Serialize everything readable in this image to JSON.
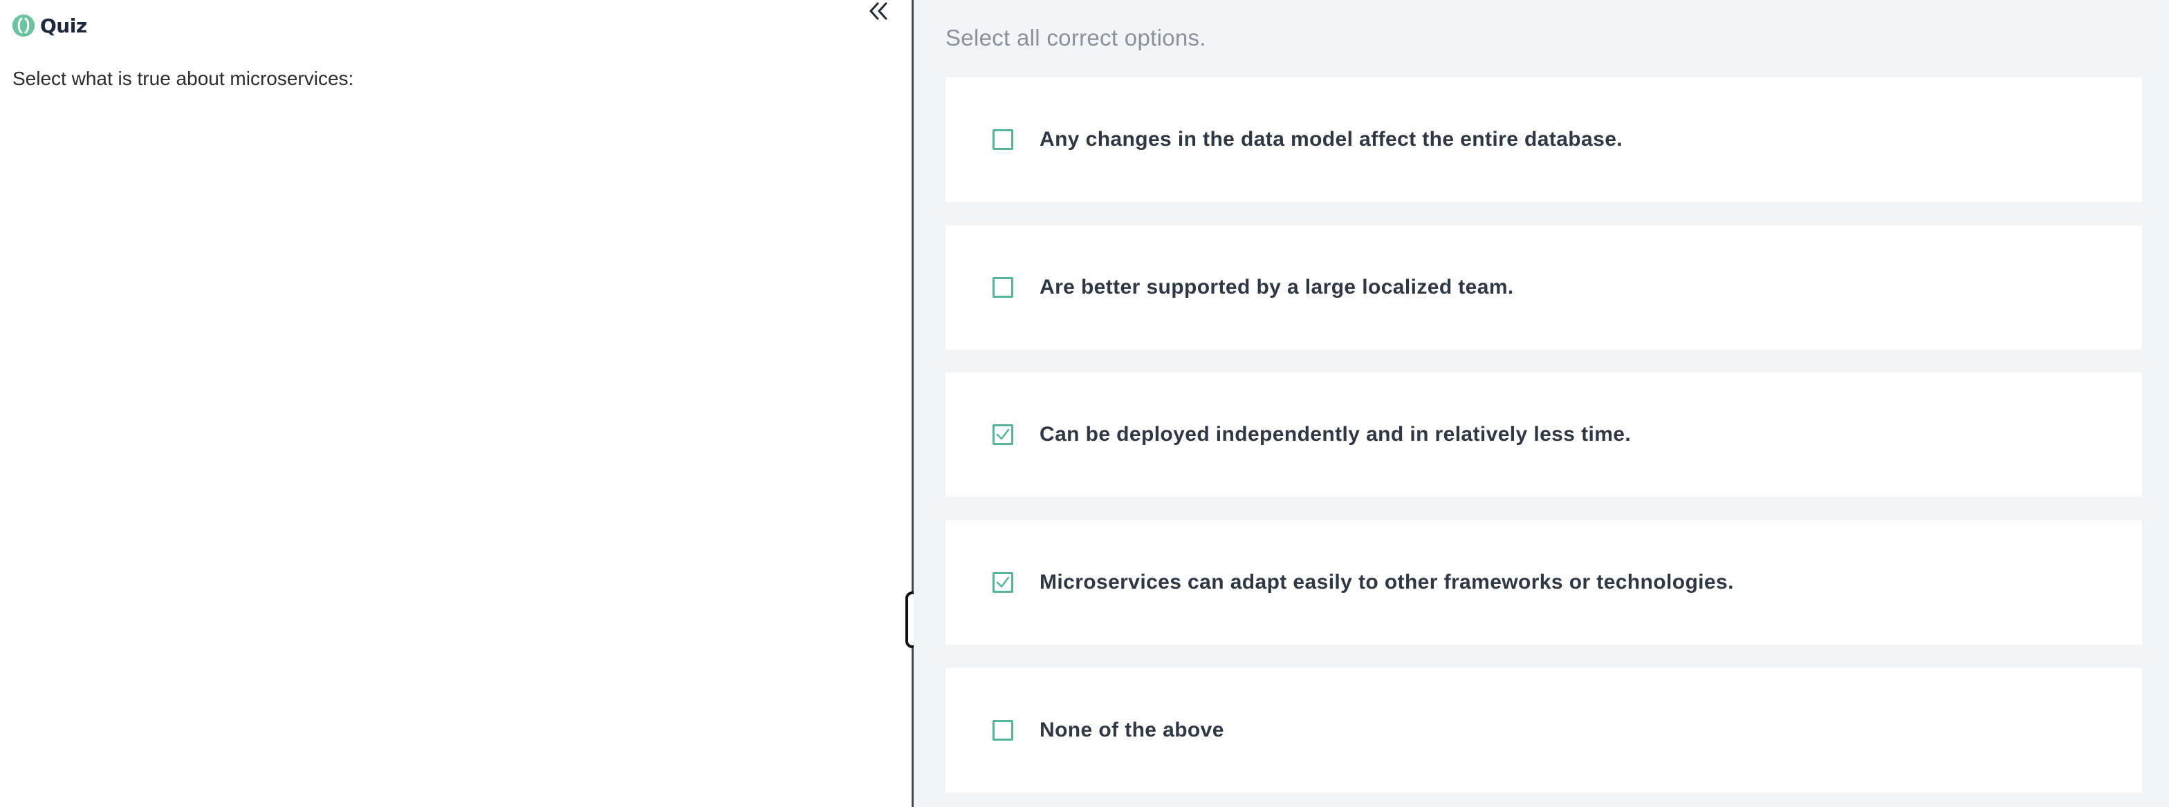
{
  "quiz": {
    "title": "Quiz",
    "question": "Select what is true about microservices:"
  },
  "answer_panel": {
    "instruction": "Select all correct options.",
    "options": [
      {
        "label": "Any changes in the data model affect the entire database.",
        "checked": false
      },
      {
        "label": "Are better supported by a large localized team.",
        "checked": false
      },
      {
        "label": "Can be deployed independently and in relatively less time.",
        "checked": true
      },
      {
        "label": "Microservices can adapt easily to other frameworks or technologies.",
        "checked": true
      },
      {
        "label": "None of the above",
        "checked": false
      }
    ]
  },
  "icons": {
    "logo": "quiz-logo-icon",
    "collapse": "double-chevron-left-icon",
    "checkmark": "checkmark-icon"
  },
  "colors": {
    "accent": "#56b49a",
    "logo": "#6cc3a2",
    "panel_background": "#f3f4f6",
    "card_background": "#ffffff",
    "instruction_text": "#8a919c"
  }
}
